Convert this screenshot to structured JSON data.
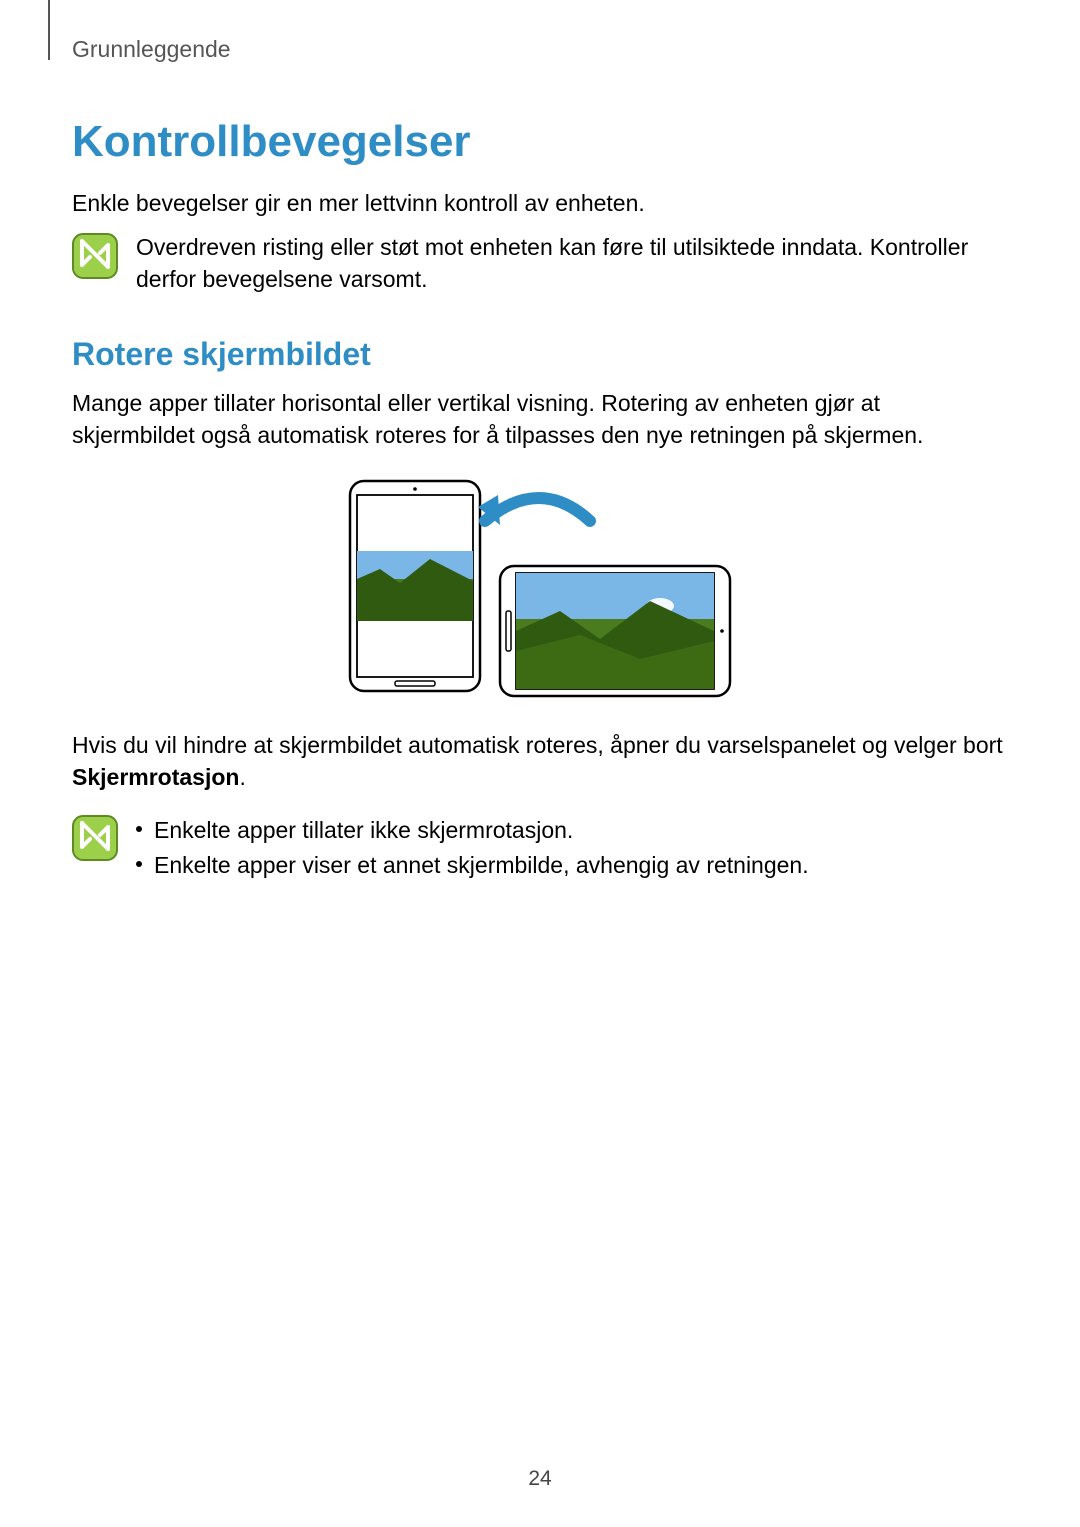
{
  "breadcrumb": "Grunnleggende",
  "h1": "Kontrollbevegelser",
  "intro": "Enkle bevegelser gir en mer lettvinn kontroll av enheten.",
  "note1": "Overdreven risting eller støt mot enheten kan føre til utilsiktede inndata. Kontroller derfor bevegelsene varsomt.",
  "h2": "Rotere skjermbildet",
  "body1": "Mange apper tillater horisontal eller vertikal visning. Rotering av enheten gjør at skjermbildet også automatisk roteres for å tilpasses den nye retningen på skjermen.",
  "body2_pre": "Hvis du vil hindre at skjermbildet automatisk roteres, åpner du varselspanelet og velger bort ",
  "body2_bold": "Skjermrotasjon",
  "body2_post": ".",
  "bullets": {
    "0": "Enkelte apper tillater ikke skjermrotasjon.",
    "1": "Enkelte apper viser et annet skjermbilde, avhengig av retningen."
  },
  "page_number": "24"
}
